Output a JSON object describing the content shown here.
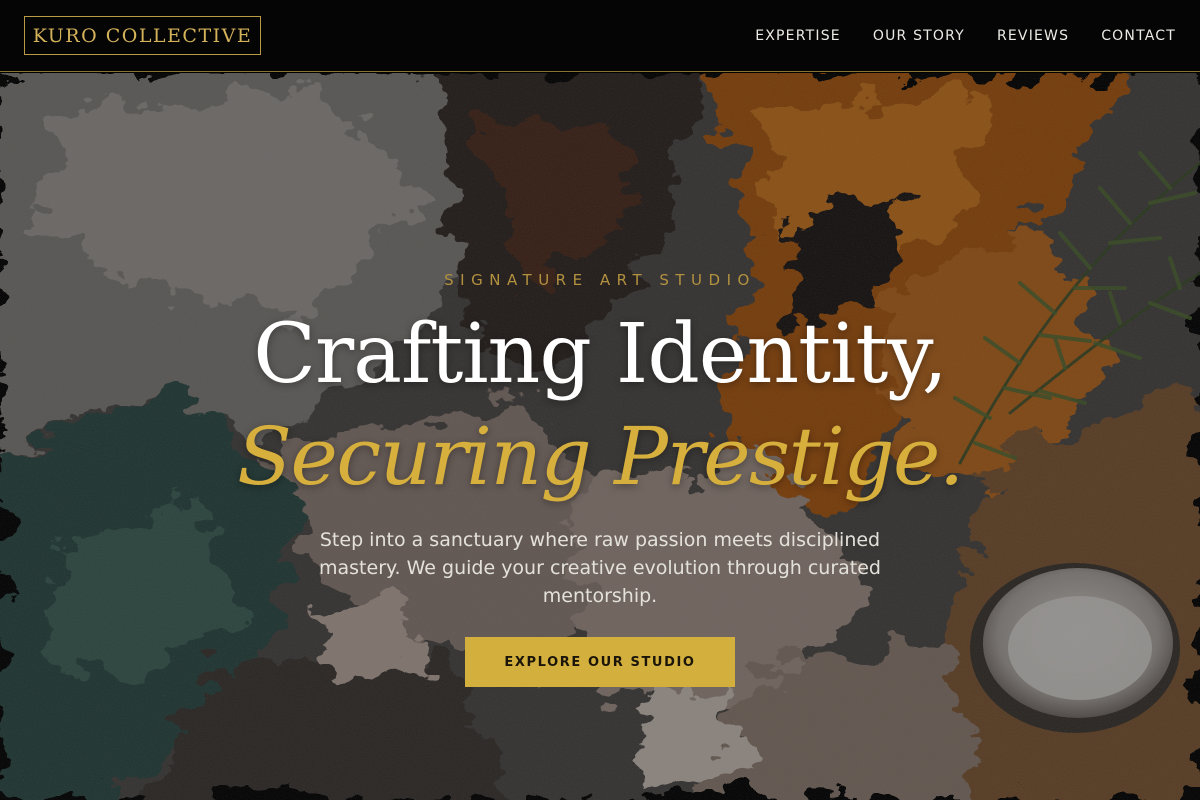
{
  "header": {
    "logo_text": "KURO COLLECTIVE",
    "nav": [
      {
        "label": "EXPERTISE"
      },
      {
        "label": "OUR STORY"
      },
      {
        "label": "REVIEWS"
      },
      {
        "label": "CONTACT"
      }
    ]
  },
  "hero": {
    "eyebrow": "SIGNATURE ART STUDIO",
    "title_line1": "Crafting Identity,",
    "title_line2": "Securing Prestige.",
    "description": "Step into a sanctuary where raw passion meets disciplined mastery. We guide your creative evolution through curated mentorship.",
    "cta_label": "EXPLORE OUR STUDIO"
  },
  "colors": {
    "accent_gold": "#d3b03e",
    "header_bg": "#050505",
    "text_light": "#ffffff"
  }
}
